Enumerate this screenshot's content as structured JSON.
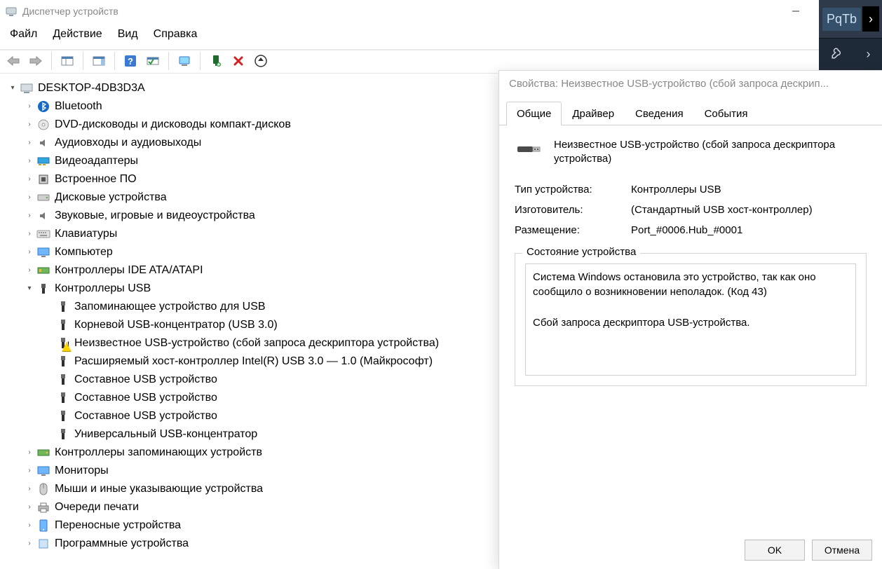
{
  "window": {
    "title": "Диспетчер устройств"
  },
  "menu": {
    "file": "Файл",
    "action": "Действие",
    "view": "Вид",
    "help": "Справка"
  },
  "tree": {
    "root": "DESKTOP-4DB3D3A",
    "items": [
      {
        "label": "Bluetooth",
        "icon": "bluetooth"
      },
      {
        "label": "DVD-дисководы и дисководы компакт-дисков",
        "icon": "dvd"
      },
      {
        "label": "Аудиовходы и аудиовыходы",
        "icon": "audio"
      },
      {
        "label": "Видеоадаптеры",
        "icon": "display-adapter"
      },
      {
        "label": "Встроенное ПО",
        "icon": "firmware"
      },
      {
        "label": "Дисковые устройства",
        "icon": "disk"
      },
      {
        "label": "Звуковые, игровые и видеоустройства",
        "icon": "sound"
      },
      {
        "label": "Клавиатуры",
        "icon": "keyboard"
      },
      {
        "label": "Компьютер",
        "icon": "monitor"
      },
      {
        "label": "Контроллеры IDE ATA/ATAPI",
        "icon": "ide"
      }
    ],
    "usb_label": "Контроллеры USB",
    "usb_children": [
      {
        "label": "Запоминающее устройство для USB",
        "icon": "usb",
        "warn": false
      },
      {
        "label": "Корневой USB-концентратор (USB 3.0)",
        "icon": "usb",
        "warn": false
      },
      {
        "label": "Неизвестное USB-устройство (сбой запроса дескриптора устройства)",
        "icon": "usb",
        "warn": true
      },
      {
        "label": "Расширяемый хост-контроллер Intel(R) USB 3.0 — 1.0 (Майкрософт)",
        "icon": "usb",
        "warn": false
      },
      {
        "label": "Составное USB устройство",
        "icon": "usb",
        "warn": false
      },
      {
        "label": "Составное USB устройство",
        "icon": "usb",
        "warn": false
      },
      {
        "label": "Составное USB устройство",
        "icon": "usb",
        "warn": false
      },
      {
        "label": "Универсальный USB-концентратор",
        "icon": "usb",
        "warn": false
      }
    ],
    "after": [
      {
        "label": "Контроллеры запоминающих устройств",
        "icon": "storage-ctrl"
      },
      {
        "label": "Мониторы",
        "icon": "monitor"
      },
      {
        "label": "Мыши и иные указывающие устройства",
        "icon": "mouse"
      },
      {
        "label": "Очереди печати",
        "icon": "printer"
      },
      {
        "label": "Переносные устройства",
        "icon": "tablet"
      },
      {
        "label": "Программные устройства",
        "icon": "software"
      }
    ]
  },
  "dialog": {
    "title": "Свойства: Неизвестное USB-устройство (сбой запроса дескрип...",
    "tabs": {
      "general": "Общие",
      "driver": "Драйвер",
      "details": "Сведения",
      "events": "События"
    },
    "device_name": "Неизвестное USB-устройство (сбой запроса дескриптора устройства)",
    "rows": {
      "type_k": "Тип устройства:",
      "type_v": "Контроллеры USB",
      "mfr_k": "Изготовитель:",
      "mfr_v": "(Стандартный USB хост-контроллер)",
      "loc_k": "Размещение:",
      "loc_v": "Port_#0006.Hub_#0001"
    },
    "status_legend": "Состояние устройства",
    "status_line1": "Система Windows остановила это устройство, так как оно сообщило о возникновении неполадок. (Код 43)",
    "status_line2": "Сбой запроса дескриптора USB-устройства.",
    "ok": "OK",
    "cancel": "Отмена"
  },
  "rstrip": {
    "label": "PqTb"
  }
}
